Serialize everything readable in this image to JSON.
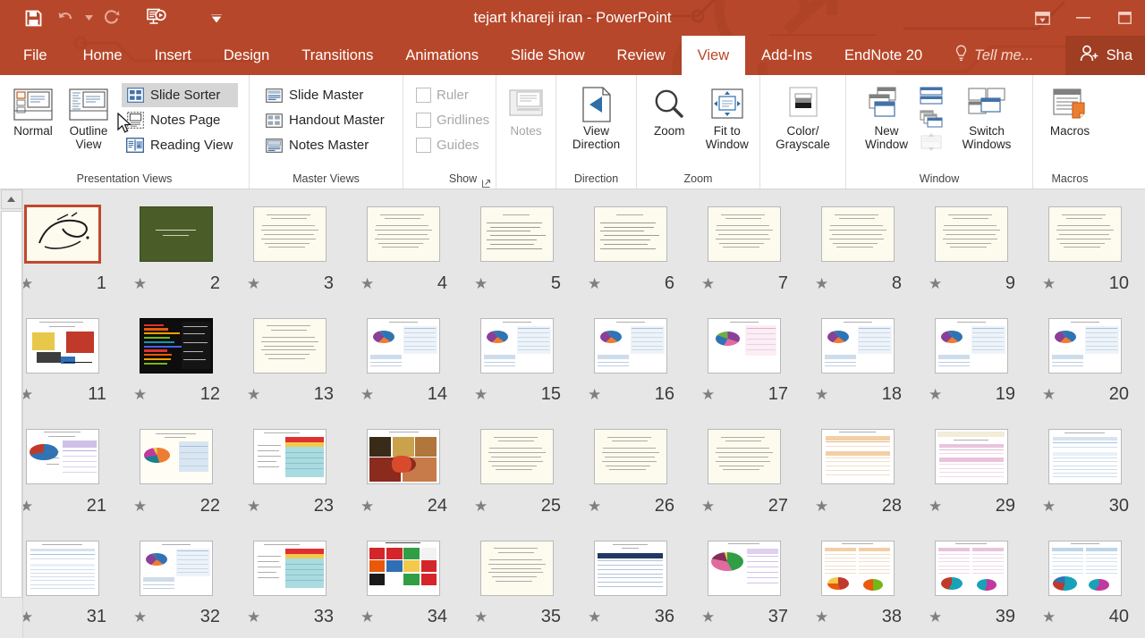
{
  "window": {
    "title": "tejart khareji iran - PowerPoint",
    "accent_color": "#b7472a",
    "quick_access": [
      {
        "name": "save-icon",
        "label": "Save",
        "enabled": true
      },
      {
        "name": "undo-icon",
        "label": "Undo",
        "enabled": false
      },
      {
        "name": "redo-icon",
        "label": "Redo",
        "enabled": false
      },
      {
        "name": "start-presentation-icon",
        "label": "Start From Beginning",
        "enabled": true
      },
      {
        "name": "customize-quick-access-icon",
        "label": "Customize Quick Access Toolbar",
        "enabled": true
      }
    ],
    "controls": [
      {
        "name": "ribbon-display-options-icon",
        "label": "Ribbon Display Options"
      },
      {
        "name": "minimize-icon",
        "label": "Minimize"
      },
      {
        "name": "restore-icon",
        "label": "Restore Down"
      }
    ]
  },
  "tabs": [
    {
      "label": "File",
      "active": false
    },
    {
      "label": "Home",
      "active": false
    },
    {
      "label": "Insert",
      "active": false
    },
    {
      "label": "Design",
      "active": false
    },
    {
      "label": "Transitions",
      "active": false
    },
    {
      "label": "Animations",
      "active": false
    },
    {
      "label": "Slide Show",
      "active": false
    },
    {
      "label": "Review",
      "active": false
    },
    {
      "label": "View",
      "active": true
    },
    {
      "label": "Add-Ins",
      "active": false
    },
    {
      "label": "EndNote 20",
      "active": false
    }
  ],
  "tell_me": {
    "label": "Tell me..."
  },
  "share": {
    "label": "Sha"
  },
  "ribbon": {
    "groups": [
      {
        "name": "presentation-views",
        "label": "Presentation Views",
        "big_buttons": [
          {
            "label": "Normal",
            "icon": "normal-view-icon",
            "enabled": true
          },
          {
            "label": "Outline View",
            "icon": "outline-view-icon",
            "enabled": true
          }
        ],
        "small_buttons": [
          {
            "label": "Slide Sorter",
            "icon": "slide-sorter-icon",
            "selected": true,
            "enabled": true
          },
          {
            "label": "Notes Page",
            "icon": "notes-page-icon",
            "selected": false,
            "enabled": true
          },
          {
            "label": "Reading View",
            "icon": "reading-view-icon",
            "selected": false,
            "enabled": true
          }
        ]
      },
      {
        "name": "master-views",
        "label": "Master Views",
        "small_buttons": [
          {
            "label": "Slide Master",
            "icon": "slide-master-icon",
            "enabled": true
          },
          {
            "label": "Handout Master",
            "icon": "handout-master-icon",
            "enabled": true
          },
          {
            "label": "Notes Master",
            "icon": "notes-master-icon",
            "enabled": true
          }
        ]
      },
      {
        "name": "show",
        "label": "Show",
        "checkboxes": [
          {
            "label": "Ruler",
            "checked": false,
            "enabled": false
          },
          {
            "label": "Gridlines",
            "checked": false,
            "enabled": false
          },
          {
            "label": "Guides",
            "checked": false,
            "enabled": false
          }
        ],
        "has_dialog_launcher": true,
        "notes_button": {
          "label": "Notes",
          "icon": "notes-icon",
          "enabled": false
        }
      },
      {
        "name": "direction",
        "label": "Direction",
        "big_buttons": [
          {
            "label": "View Direction",
            "icon": "view-direction-icon",
            "has_dropdown": true,
            "enabled": true
          }
        ]
      },
      {
        "name": "zoom",
        "label": "Zoom",
        "big_buttons": [
          {
            "label": "Zoom",
            "icon": "zoom-icon",
            "enabled": true
          },
          {
            "label": "Fit to Window",
            "icon": "fit-to-window-icon",
            "enabled": true
          }
        ]
      },
      {
        "name": "color-grayscale",
        "label": "",
        "big_buttons": [
          {
            "label": "Color/ Grayscale",
            "icon": "color-grayscale-icon",
            "has_dropdown": true,
            "enabled": true
          }
        ]
      },
      {
        "name": "window",
        "label": "Window",
        "big_buttons": [
          {
            "label": "New Window",
            "icon": "new-window-icon",
            "enabled": true
          },
          {
            "label": "Switch Windows",
            "icon": "switch-windows-icon",
            "has_dropdown": true,
            "enabled": true
          }
        ],
        "small_icons": [
          {
            "name": "arrange-all-icon",
            "enabled": true
          },
          {
            "name": "cascade-icon",
            "enabled": true
          },
          {
            "name": "move-split-icon",
            "enabled": false
          }
        ]
      },
      {
        "name": "macros",
        "label": "Macros",
        "big_buttons": [
          {
            "label": "Macros",
            "icon": "macros-icon",
            "enabled": true
          }
        ]
      }
    ]
  },
  "sorter": {
    "scrollbar": {
      "name": "vertical-scrollbar",
      "arrow": "scroll-up-arrow-icon"
    },
    "star_glyph": "★",
    "rows": [
      [
        {
          "num": "10",
          "style": "text-cream",
          "selected": false
        },
        {
          "num": "9",
          "style": "text-cream",
          "selected": false
        },
        {
          "num": "8",
          "style": "text-cream",
          "selected": false
        },
        {
          "num": "7",
          "style": "text-cream",
          "selected": false
        },
        {
          "num": "6",
          "style": "text-cream-dense",
          "selected": false
        },
        {
          "num": "5",
          "style": "text-cream-dense",
          "selected": false
        },
        {
          "num": "4",
          "style": "text-cream",
          "selected": false
        },
        {
          "num": "3",
          "style": "text-cream",
          "selected": false
        },
        {
          "num": "2",
          "style": "dark-green",
          "selected": false
        },
        {
          "num": "1",
          "style": "calligraphy",
          "selected": true
        }
      ],
      [
        {
          "num": "20",
          "style": "chart-table-blue",
          "selected": false
        },
        {
          "num": "19",
          "style": "chart-table-blue",
          "selected": false
        },
        {
          "num": "18",
          "style": "chart-table-blue",
          "selected": false
        },
        {
          "num": "17",
          "style": "chart-pink-table",
          "selected": false
        },
        {
          "num": "16",
          "style": "chart-table-blue",
          "selected": false
        },
        {
          "num": "15",
          "style": "chart-table-blue",
          "selected": false
        },
        {
          "num": "14",
          "style": "chart-table-blue",
          "selected": false
        },
        {
          "num": "13",
          "style": "text-cream",
          "selected": false
        },
        {
          "num": "12",
          "style": "dark-chart",
          "selected": false
        },
        {
          "num": "11",
          "style": "cartoon-china",
          "selected": false
        }
      ],
      [
        {
          "num": "30",
          "style": "table-blue",
          "selected": false
        },
        {
          "num": "29",
          "style": "table-pink",
          "selected": false
        },
        {
          "num": "28",
          "style": "table-orange",
          "selected": false
        },
        {
          "num": "27",
          "style": "text-cream",
          "selected": false
        },
        {
          "num": "26",
          "style": "text-cream",
          "selected": false
        },
        {
          "num": "25",
          "style": "text-cream",
          "selected": false
        },
        {
          "num": "24",
          "style": "food-photos",
          "selected": false
        },
        {
          "num": "23",
          "style": "table-cyan-red",
          "selected": false
        },
        {
          "num": "22",
          "style": "pie-table-blue",
          "selected": false
        },
        {
          "num": "21",
          "style": "pie-purple-table",
          "selected": false
        }
      ],
      [
        {
          "num": "40",
          "style": "table-cyan-pie",
          "selected": false
        },
        {
          "num": "39",
          "style": "table-pink-pie",
          "selected": false
        },
        {
          "num": "38",
          "style": "table-orange-pie",
          "selected": false
        },
        {
          "num": "37",
          "style": "pie-green-pink",
          "selected": false
        },
        {
          "num": "36",
          "style": "table-navy",
          "selected": false
        },
        {
          "num": "35",
          "style": "text-cream",
          "selected": false
        },
        {
          "num": "34",
          "style": "flags",
          "selected": false
        },
        {
          "num": "33",
          "style": "table-cyan-red",
          "selected": false
        },
        {
          "num": "32",
          "style": "chart-table-blue",
          "selected": false
        },
        {
          "num": "31",
          "style": "table-blue",
          "selected": false
        }
      ]
    ]
  }
}
